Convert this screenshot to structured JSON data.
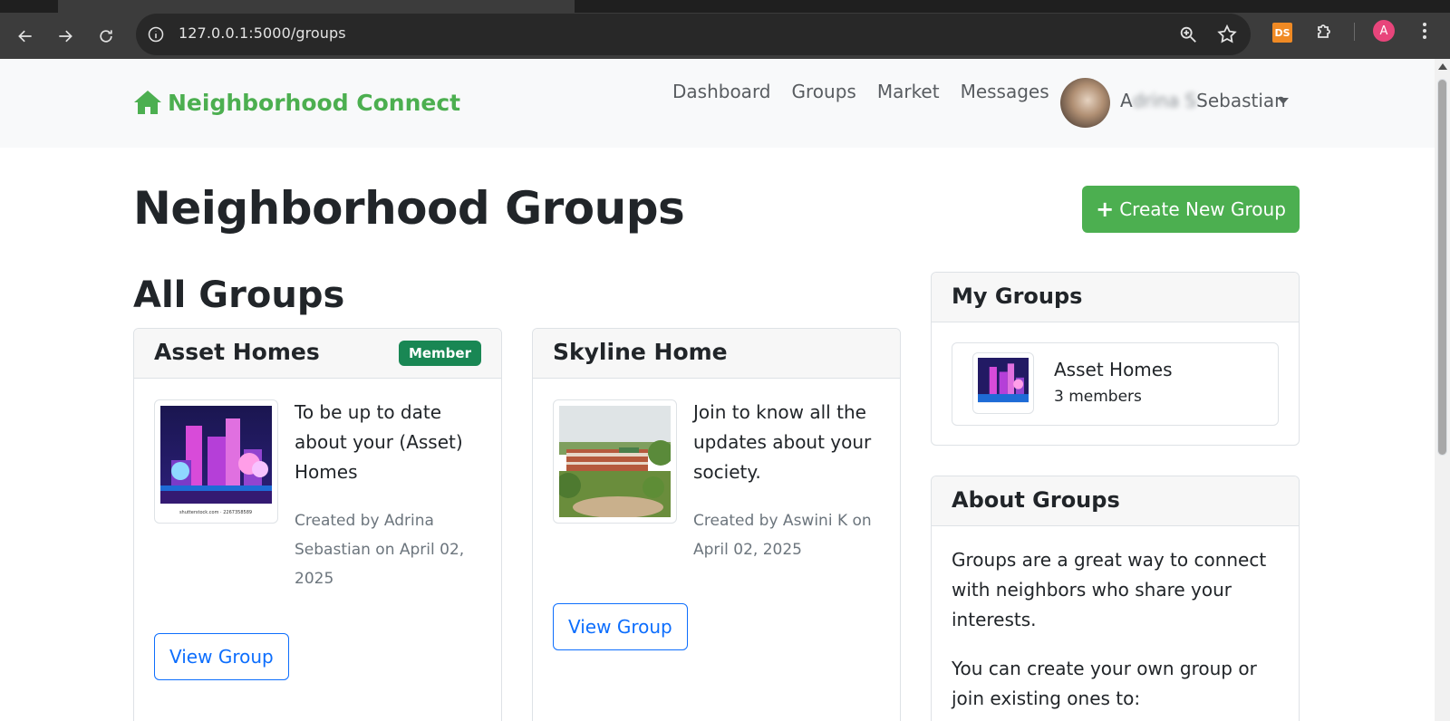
{
  "browser": {
    "url": "127.0.0.1:5000/groups",
    "extension_label": "DS",
    "profile_initial": "A"
  },
  "navbar": {
    "brand": "Neighborhood Connect",
    "links": [
      "Dashboard",
      "Groups",
      "Market",
      "Messages"
    ],
    "user_name_visible": "Sebastian",
    "user_name_obscured": "A"
  },
  "page": {
    "title": "Neighborhood Groups",
    "create_button": "Create New Group",
    "section_title": "All Groups"
  },
  "groups": [
    {
      "name": "Asset Homes",
      "badge": "Member",
      "description": "To be up to date about your (Asset) Homes",
      "meta": "Created by Adrina Sebastian on April 02, 2025",
      "image_caption": "shutterstock.com · 2267358589",
      "button": "View Group"
    },
    {
      "name": "Skyline Home",
      "description": "Join to know all the updates about your society.",
      "meta": "Created by Aswini K on April 02, 2025",
      "button": "View Group"
    }
  ],
  "sidebar": {
    "my_groups_title": "My Groups",
    "my_groups": [
      {
        "name": "Asset Homes",
        "members": "3 members"
      }
    ],
    "about_title": "About Groups",
    "about_paragraphs": [
      "Groups are a great way to connect with neighbors who share your interests.",
      "You can create your own group or join existing ones to:"
    ]
  },
  "colors": {
    "brand_green": "#4caf50",
    "badge_green": "#198754",
    "link_blue": "#0d6efd"
  }
}
